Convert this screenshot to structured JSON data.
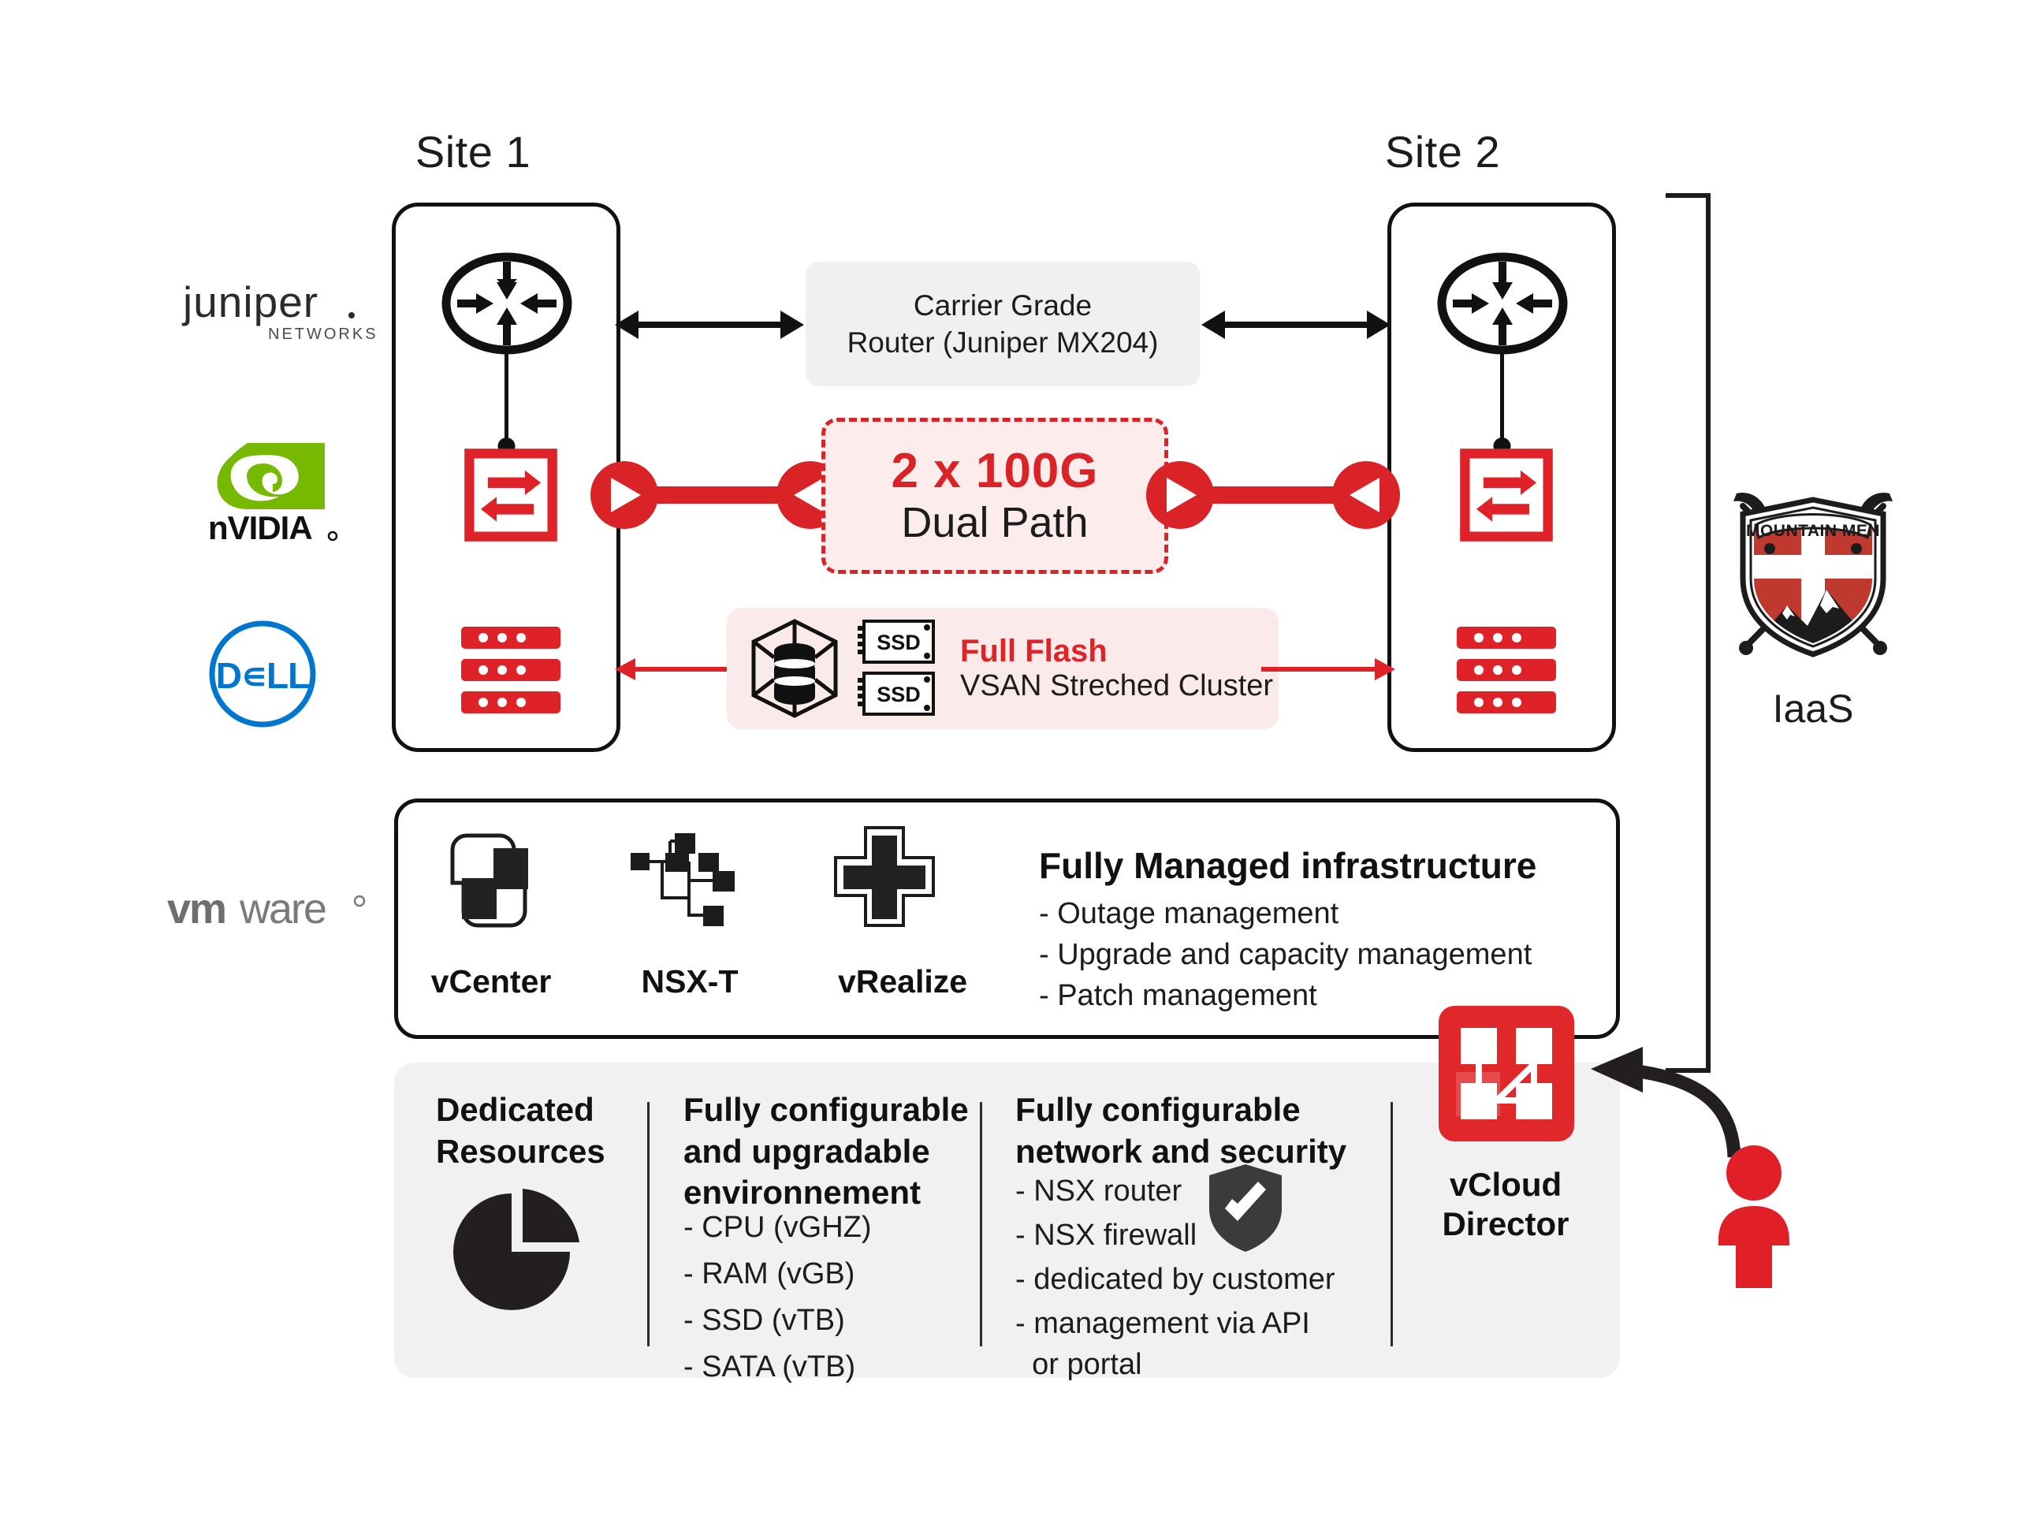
{
  "diagram": {
    "sites": [
      {
        "title": "Site 1",
        "icons": [
          "router-icon",
          "switch-icon",
          "server-stack-icon"
        ]
      },
      {
        "title": "Site 2",
        "icons": [
          "router-icon",
          "switch-icon",
          "server-stack-icon"
        ]
      }
    ],
    "carrier_router": {
      "line1": "Carrier Grade",
      "line2": "Router (Juniper MX204)"
    },
    "dual_path": {
      "headline": "2 x 100G",
      "subline": "Dual Path"
    },
    "storage": {
      "title": "Full Flash",
      "subtitle": "VSAN Streched Cluster",
      "ssd_label": "SSD"
    },
    "vendor_logos": [
      {
        "name": "juniper",
        "word": "juniper",
        "sub": "NETWORKS"
      },
      {
        "name": "nvidia",
        "word": "nVIDIA"
      },
      {
        "name": "dell",
        "word": "D∈LL"
      },
      {
        "name": "vmware",
        "bold": "vm",
        "light": "ware"
      }
    ],
    "managed": {
      "title": "Fully Managed infrastructure",
      "items": [
        "- Outage management",
        "- Upgrade and capacity management",
        "- Patch management"
      ],
      "products": [
        {
          "label": "vCenter",
          "icon": "vcenter-icon"
        },
        {
          "label": "NSX-T",
          "icon": "nsxt-icon"
        },
        {
          "label": "vRealize",
          "icon": "vrealize-icon"
        }
      ]
    },
    "bottom_columns": [
      {
        "title": "Dedicated\nResources",
        "title_lines": [
          "Dedicated",
          "Resources"
        ],
        "icon": "pie-chart-icon",
        "items": []
      },
      {
        "title_lines": [
          "Fully configurable",
          "and upgradable",
          "environnement"
        ],
        "items": [
          "- CPU (vGHZ)",
          "- RAM (vGB)",
          "- SSD (vTB)",
          "- SATA (vTB)"
        ]
      },
      {
        "title_lines": [
          "Fully configurable",
          "network and security"
        ],
        "icon": "shield-check-icon",
        "items": [
          "- NSX router",
          "- NSX firewall",
          "- dedicated by customer",
          "- management via API",
          "  or portal"
        ]
      }
    ],
    "vcloud": {
      "line1": "vCloud",
      "line2": "Director",
      "icon": "vcloud-director-icon"
    },
    "brand": {
      "shield_text": "MOUNTAIN MEN",
      "service_label": "IaaS"
    },
    "colors": {
      "red": "#d92327",
      "red_dark": "#c51f22",
      "pink_bg": "#fbeaea",
      "pink_bg_light": "#fdecec",
      "grey_bg": "#f1f1f1",
      "chip_grey": "#f0f0f0",
      "ink": "#1c1c1c",
      "nvidia_green": "#76b900",
      "dell_blue": "#0076ce",
      "vmware_grey": "#6e6e6e"
    }
  }
}
